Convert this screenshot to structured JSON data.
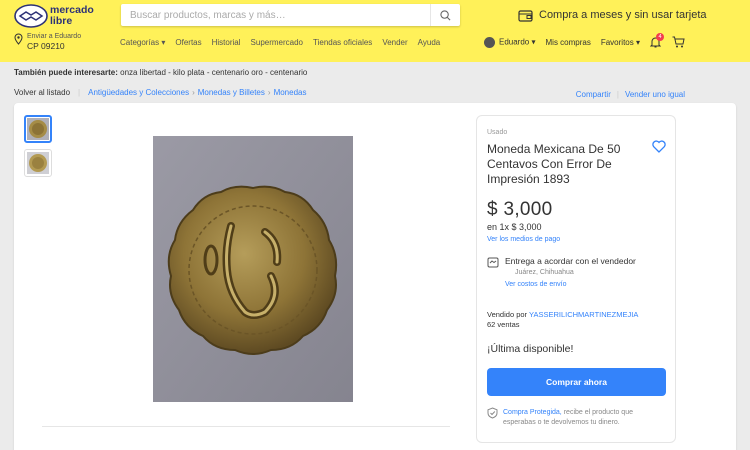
{
  "header": {
    "logo_line1": "mercado",
    "logo_line2": "libre",
    "search_placeholder": "Buscar productos, marcas y más…",
    "promo_text": "Compra a meses y sin usar tarjeta",
    "location_small": "Enviar a Eduardo",
    "location_big": "CP 09210",
    "nav": [
      "Categorías",
      "Ofertas",
      "Historial",
      "Supermercado",
      "Tiendas oficiales",
      "Vender",
      "Ayuda"
    ],
    "user": "Eduardo",
    "my_purchases": "Mis compras",
    "favorites": "Favoritos",
    "notifications_count": "4",
    "colors": {
      "bar": "#fff159",
      "brand": "#2d3277"
    }
  },
  "also_interested": {
    "label": "También puede interesarte:",
    "items": "onza libertad - kilo plata - centenario oro - centenario"
  },
  "breadcrumb": {
    "back": "Volver al listado",
    "path": [
      "Antigüedades y Colecciones",
      "Monedas y Billetes",
      "Monedas"
    ],
    "share": "Compartir",
    "sell_same": "Vender uno igual"
  },
  "product": {
    "condition": "Usado",
    "title": "Moneda Mexicana De 50 Centavos Con Error De Impresión 1893",
    "price": "$ 3,000",
    "installments": "en 1x $ 3,000",
    "payment_link": "Ver los medios de pago",
    "shipping_text": "Entrega a acordar con el vendedor",
    "shipping_city": "Juárez, Chihuahua",
    "shipping_cost_link": "Ver costos de envío",
    "seller_label": "Vendido por",
    "seller_name": "YASSERILICHMARTINEZMEJIA",
    "sales": "62 ventas",
    "stock": "¡Última disponible!",
    "buy_button": "Comprar ahora",
    "protect_link": "Compra Protegida,",
    "protect_text": "recibe el producto que esperabas o te devolvemos tu dinero.",
    "accent": "#3483fa"
  }
}
